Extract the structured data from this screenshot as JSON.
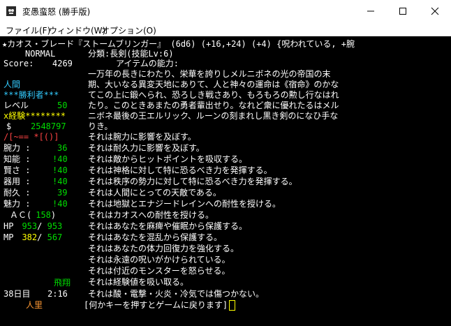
{
  "window": {
    "title": "変愚蛮怒 (勝手版)",
    "menu": [
      "ファイル(F)",
      "ウィンドウ(W)",
      "オプション(O)"
    ]
  },
  "status": {
    "difficulty": "NORMAL",
    "score_label": "Score:",
    "score": "4269",
    "race": "人間",
    "winner": "***勝利者***",
    "level_label": "レベル",
    "level": "50",
    "exp_label": "x経験********",
    "gold_label": "$",
    "gold": "2548797",
    "equip_glyphs": "/[~== *[()]",
    "stats": [
      {
        "label": "腕力 :",
        "value": "36"
      },
      {
        "label": "知能 :",
        "value": "!40"
      },
      {
        "label": "賢さ :",
        "value": "!40"
      },
      {
        "label": "器用 :",
        "value": "!40"
      },
      {
        "label": "耐久 :",
        "value": "39"
      },
      {
        "label": "魅力 :",
        "value": "!40"
      }
    ],
    "ac_label": "ＡＣ(",
    "ac": "158",
    "ac_close": ")",
    "hp_label": "HP",
    "hp_cur": "953",
    "hp_max": "953",
    "mp_label": "MP",
    "mp_cur": "382",
    "mp_max": "567",
    "levitation": "飛翔",
    "day": "38日目",
    "time": "2:16",
    "location": "人里"
  },
  "item": {
    "header_prefix": "★",
    "header": "カオス・ブレード『ストームブリンガー』 (6d6) (+16,+24) (+4) {呪われている, +腕",
    "category": "分類:長剣(技能Lv:6)",
    "abilities_heading": "アイテムの能力:",
    "description": [
      "一万年の長きにわたり、栄華を誇りしメルニボネの光の帝国の末",
      "期、大いなる異変天地にありて、人と神々の運命は《宿命》のかな",
      "てこの上に鍛へられ、恐ろしき戦さあり、もろもろの勲し行なはれ",
      "たり。このときあまたの勇者輩出せり。なれど衆に優れたるはメル",
      "ニボネ最後の王エルリック、ルーンの刻まれし黒き剣のになひ手な",
      "りき。"
    ],
    "properties": [
      "それは腕力に影響を及ぼす。",
      "それは耐久力に影響を及ぼす。",
      "それは敵からヒットポイントを吸収する。",
      "それは神格に対して特に恐るべき力を発揮する。",
      "それは秩序の勢力に対して特に恐るべき力を発揮する。",
      "それは人間にとっての天敵である。",
      "それは地獄とエナジードレインへの耐性を授ける。",
      "それはカオスへの耐性を授ける。",
      "それはあなたを麻痺や催眠から保護する。",
      "それはあなたを混乱から保護する。",
      "それはあなたの体力回復力を強化する。",
      "それは永遠の呪いがかけられている。",
      "それは付近のモンスターを怒らせる。",
      "それは経験値を吸い取る。",
      "それは酸・電撃・火炎・冷気では傷つかない。"
    ],
    "prompt": "[何かキーを押すとゲームに戻ります]"
  }
}
